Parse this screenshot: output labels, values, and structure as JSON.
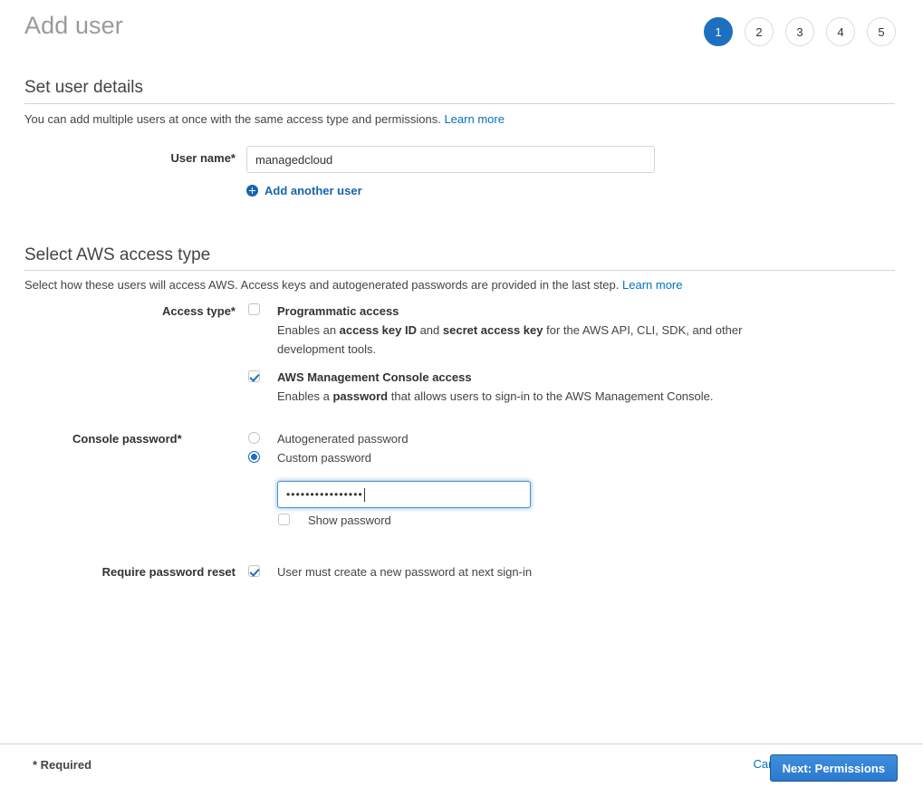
{
  "header": {
    "title": "Add user",
    "steps": [
      {
        "label": "1",
        "active": true
      },
      {
        "label": "2",
        "active": false
      },
      {
        "label": "3",
        "active": false
      },
      {
        "label": "4",
        "active": false
      },
      {
        "label": "5",
        "active": false
      }
    ]
  },
  "user_details": {
    "section_title": "Set user details",
    "description": "You can add multiple users at once with the same access type and permissions.",
    "learn_more": "Learn more",
    "user_name_label": "User name*",
    "user_name_value": "managedcloud",
    "user_name_placeholder": "",
    "add_another_label": "Add another user"
  },
  "access_type": {
    "section_title": "Select AWS access type",
    "description": "Select how these users will access AWS. Access keys and autogenerated passwords are provided in the last step.",
    "learn_more": "Learn more",
    "row_label": "Access type*",
    "programmatic": {
      "title": "Programmatic access",
      "desc_part1": "Enables an ",
      "desc_bold1": "access key ID",
      "desc_part2": " and ",
      "desc_bold2": "secret access key",
      "desc_part3": " for the AWS API, CLI, SDK, and other development tools.",
      "checked": false
    },
    "console": {
      "title": "AWS Management Console access",
      "desc_part1": "Enables a ",
      "desc_bold1": "password",
      "desc_part2": " that allows users to sign-in to the AWS Management Console.",
      "checked": true
    }
  },
  "console_password": {
    "row_label": "Console password*",
    "autogenerated_label": "Autogenerated password",
    "custom_label": "Custom password",
    "selected": "custom",
    "password_masked": "••••••••••••••••",
    "password_length": 16,
    "show_password_label": "Show password",
    "show_password_checked": false
  },
  "password_reset": {
    "row_label": "Require password reset",
    "option_label": "User must create a new password at next sign-in",
    "checked": true
  },
  "footer": {
    "required_note": "* Required",
    "cancel_label": "Cancel",
    "next_label": "Next: Permissions"
  },
  "colors": {
    "accent_blue": "#1f6fc0",
    "link_blue": "#0073bb",
    "primary_button_blue": "#2b79cd",
    "title_gray": "#9a9a9a",
    "rule_gray": "#d5d5d5"
  }
}
